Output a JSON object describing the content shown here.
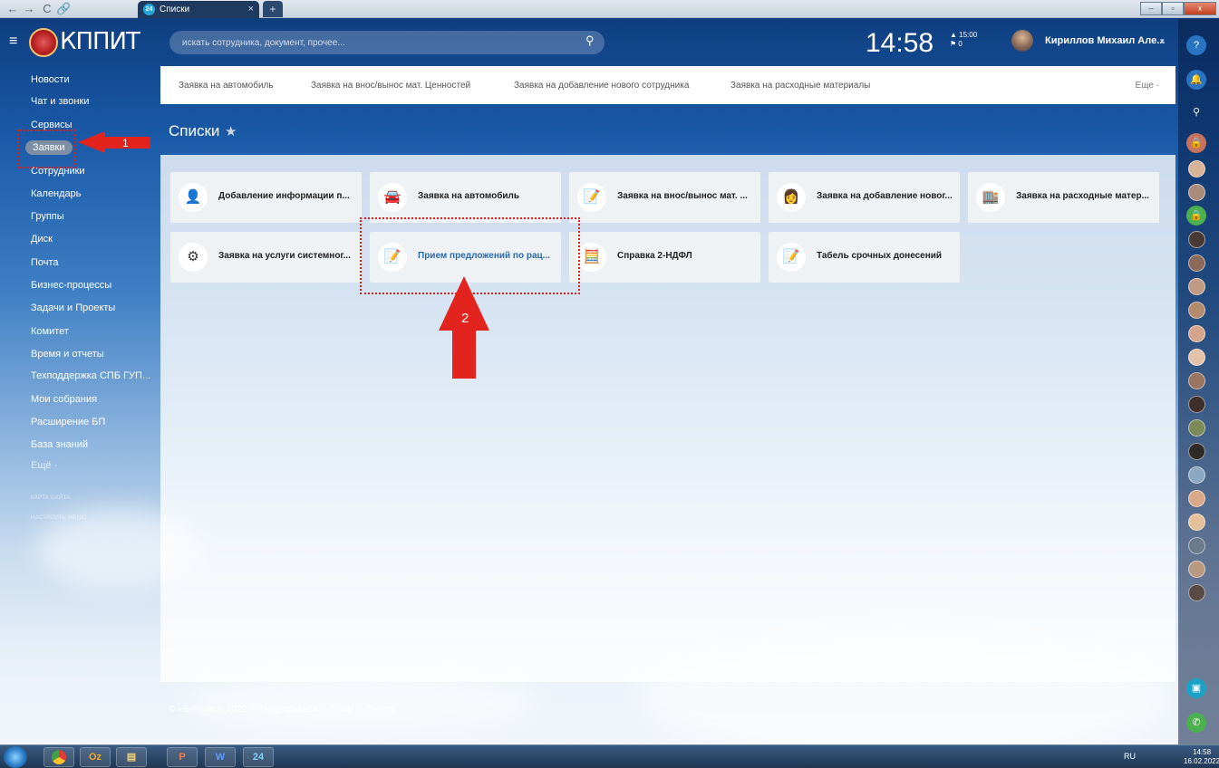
{
  "browser": {
    "back": "←",
    "forward": "→",
    "reload": "C",
    "tab_title": "Списки",
    "tab_favicon": "24",
    "tab_close": "×",
    "new_tab": "+",
    "minimize": "–",
    "maximize": "▫",
    "close": "x"
  },
  "header": {
    "logo_text": "КППИТ",
    "search_placeholder": "искать сотрудника, документ, прочее...",
    "clock": "14:58",
    "clock_next": "▲ 15:00",
    "clock_flags": "⚑ 0",
    "user_name": "Кириллов Михаил Але..."
  },
  "sidebar": {
    "items": [
      "Новости",
      "Чат и звонки",
      "Сервисы",
      "Заявки",
      "Сотрудники",
      "Календарь",
      "Группы",
      "Диск",
      "Почта",
      "Бизнес-процессы",
      "Задачи и Проекты",
      "Комитет",
      "Время и отчеты",
      "Техподдержка СПБ ГУП...",
      "Мои собрания",
      "Расширение БП",
      "База знаний",
      "Ещё ·"
    ],
    "active_index": 3,
    "sitemap": "КАРТА САЙТА",
    "configure_menu": "НАСТРОИТЬ МЕНЮ"
  },
  "top_links": {
    "items": [
      "Заявка на автомобиль",
      "Заявка на внос/вынос мат. Ценностей",
      "Заявка на добавление нового сотрудника",
      "Заявка на расходные материалы"
    ],
    "more": "Еще ·"
  },
  "page": {
    "title": "Списки"
  },
  "tiles": [
    {
      "label": "Добавление информации п...",
      "icon": "user-add-icon"
    },
    {
      "label": "Заявка на автомобиль",
      "icon": "car-icon"
    },
    {
      "label": "Заявка на внос/вынос мат. ...",
      "icon": "document-icon"
    },
    {
      "label": "Заявка на добавление новог...",
      "icon": "person-icon"
    },
    {
      "label": "Заявка на расходные матер...",
      "icon": "warehouse-icon"
    },
    {
      "label": "Заявка на услуги системног...",
      "icon": "gear-network-icon"
    },
    {
      "label": "Прием предложений по рац...",
      "icon": "document-icon"
    },
    {
      "label": "Справка 2-НДФЛ",
      "icon": "calculator-icon"
    },
    {
      "label": "Табель срочных донесений",
      "icon": "document-icon"
    }
  ],
  "annotations": {
    "label_1": "1",
    "label_2": "2"
  },
  "footer": {
    "copyright": "© «Битрикс», 2022",
    "support": "Поддержка24",
    "themes": "Темы",
    "print": "Печать"
  },
  "taskbar": {
    "lang": "RU",
    "time": "14:58",
    "date": "16.02.2022",
    "app_outlook": "Oz",
    "app_powerpoint": "P",
    "app_word": "W",
    "app_bitrix": "24"
  },
  "colors": {
    "accent_red": "#e3231e",
    "link_blue": "#2a6bb0",
    "active_item": "#7e8ea5"
  }
}
